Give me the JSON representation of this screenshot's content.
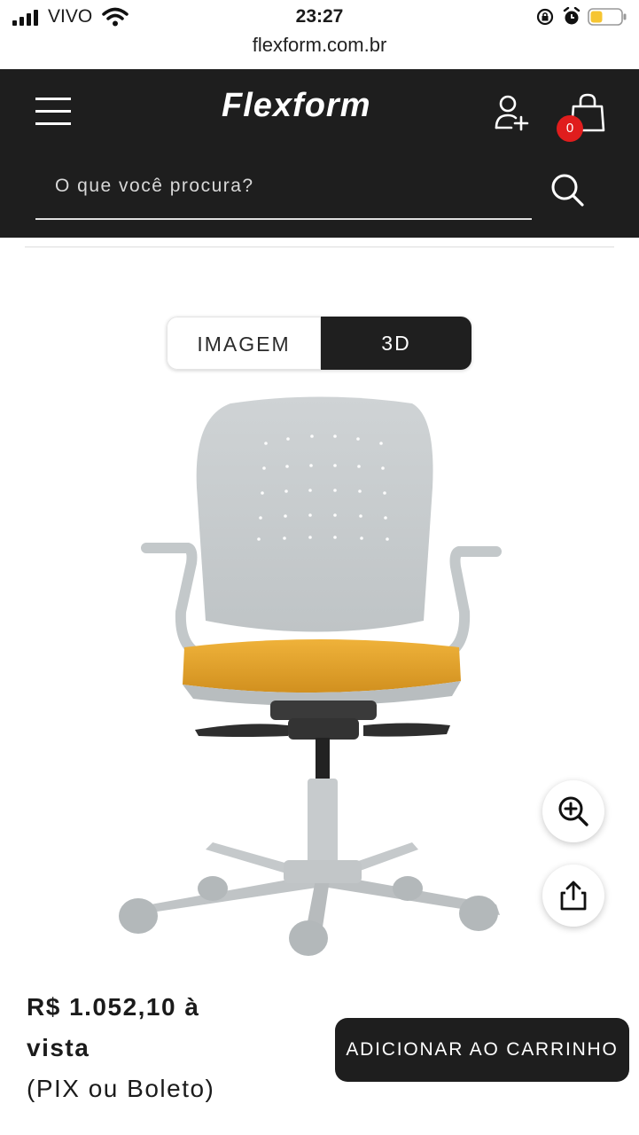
{
  "status_bar": {
    "carrier": "VIVO",
    "time": "23:27",
    "battery_color": "#f6c531"
  },
  "browser": {
    "url": "flexform.com.br"
  },
  "header": {
    "logo": "Flexform",
    "cart_count": "0",
    "background": "#1e1e1e",
    "badge_color": "#e01d1d",
    "search": {
      "placeholder": "O que você procura?",
      "value": ""
    }
  },
  "view_toggle": {
    "image_label": "IMAGEM",
    "three_d_label": "3D",
    "selected": "3D"
  },
  "product": {
    "seat_color": "#e8a52a",
    "frame_color": "#c9ccce",
    "price_line1": "R$ 1.052,10 à",
    "price_line2": "vista",
    "payment_note": "(PIX ou Boleto)",
    "add_to_cart_label": "ADICIONAR AO CARRINHO"
  }
}
